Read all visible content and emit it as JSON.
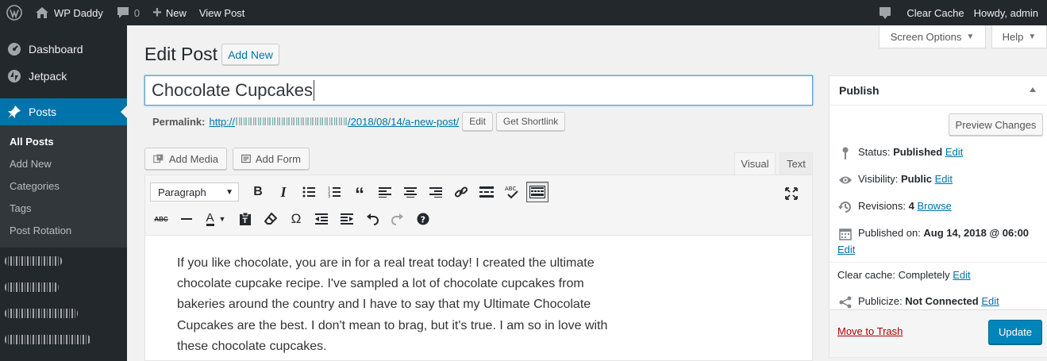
{
  "adminbar": {
    "site_name": "WP Daddy",
    "comments_count": "0",
    "new_label": "New",
    "view_post_label": "View Post",
    "clear_cache_label": "Clear Cache",
    "howdy_label": "Howdy, admin"
  },
  "sidebar": {
    "dashboard": "Dashboard",
    "jetpack": "Jetpack",
    "posts": "Posts",
    "submenu": [
      "All Posts",
      "Add New",
      "Categories",
      "Tags",
      "Post Rotation"
    ]
  },
  "screen_options": "Screen Options",
  "help": "Help",
  "page": {
    "title": "Edit Post",
    "add_new": "Add New"
  },
  "post": {
    "title": "Chocolate Cupcakes",
    "permalink_label": "Permalink:",
    "permalink_prefix": "http://",
    "permalink_suffix": "/2018/08/14/a-new-post/",
    "edit_btn": "Edit",
    "shortlink_btn": "Get Shortlink"
  },
  "editor": {
    "add_media": "Add Media",
    "add_form": "Add Form",
    "tab_visual": "Visual",
    "tab_text": "Text",
    "format_value": "Paragraph",
    "content": "If you like chocolate, you are in for a real treat today! I created the ultimate chocolate cupcake recipe. I've sampled a lot of chocolate cupcakes from bakeries around the country and I have to say that my Ultimate Chocolate Cupcakes are the best. I don't mean to brag, but it's true. I am so in love with these chocolate cupcakes."
  },
  "publish": {
    "heading": "Publish",
    "preview_btn": "Preview Changes",
    "status_label": "Status:",
    "status_value": "Published",
    "visibility_label": "Visibility:",
    "visibility_value": "Public",
    "revisions_label": "Revisions:",
    "revisions_value": "4",
    "browse_link": "Browse",
    "published_on_label": "Published on:",
    "published_on_value": "Aug 14, 2018 @ 06:00",
    "edit_link": "Edit",
    "clear_cache_label": "Clear cache:",
    "clear_cache_value": "Completely",
    "publicize_label": "Publicize:",
    "publicize_value": "Not Connected",
    "trash_link": "Move to Trash",
    "update_btn": "Update"
  },
  "colors": {
    "admin_dark": "#23282d",
    "accent_blue": "#0073aa",
    "primary_button": "#0085ba",
    "trash_red": "#a00"
  }
}
